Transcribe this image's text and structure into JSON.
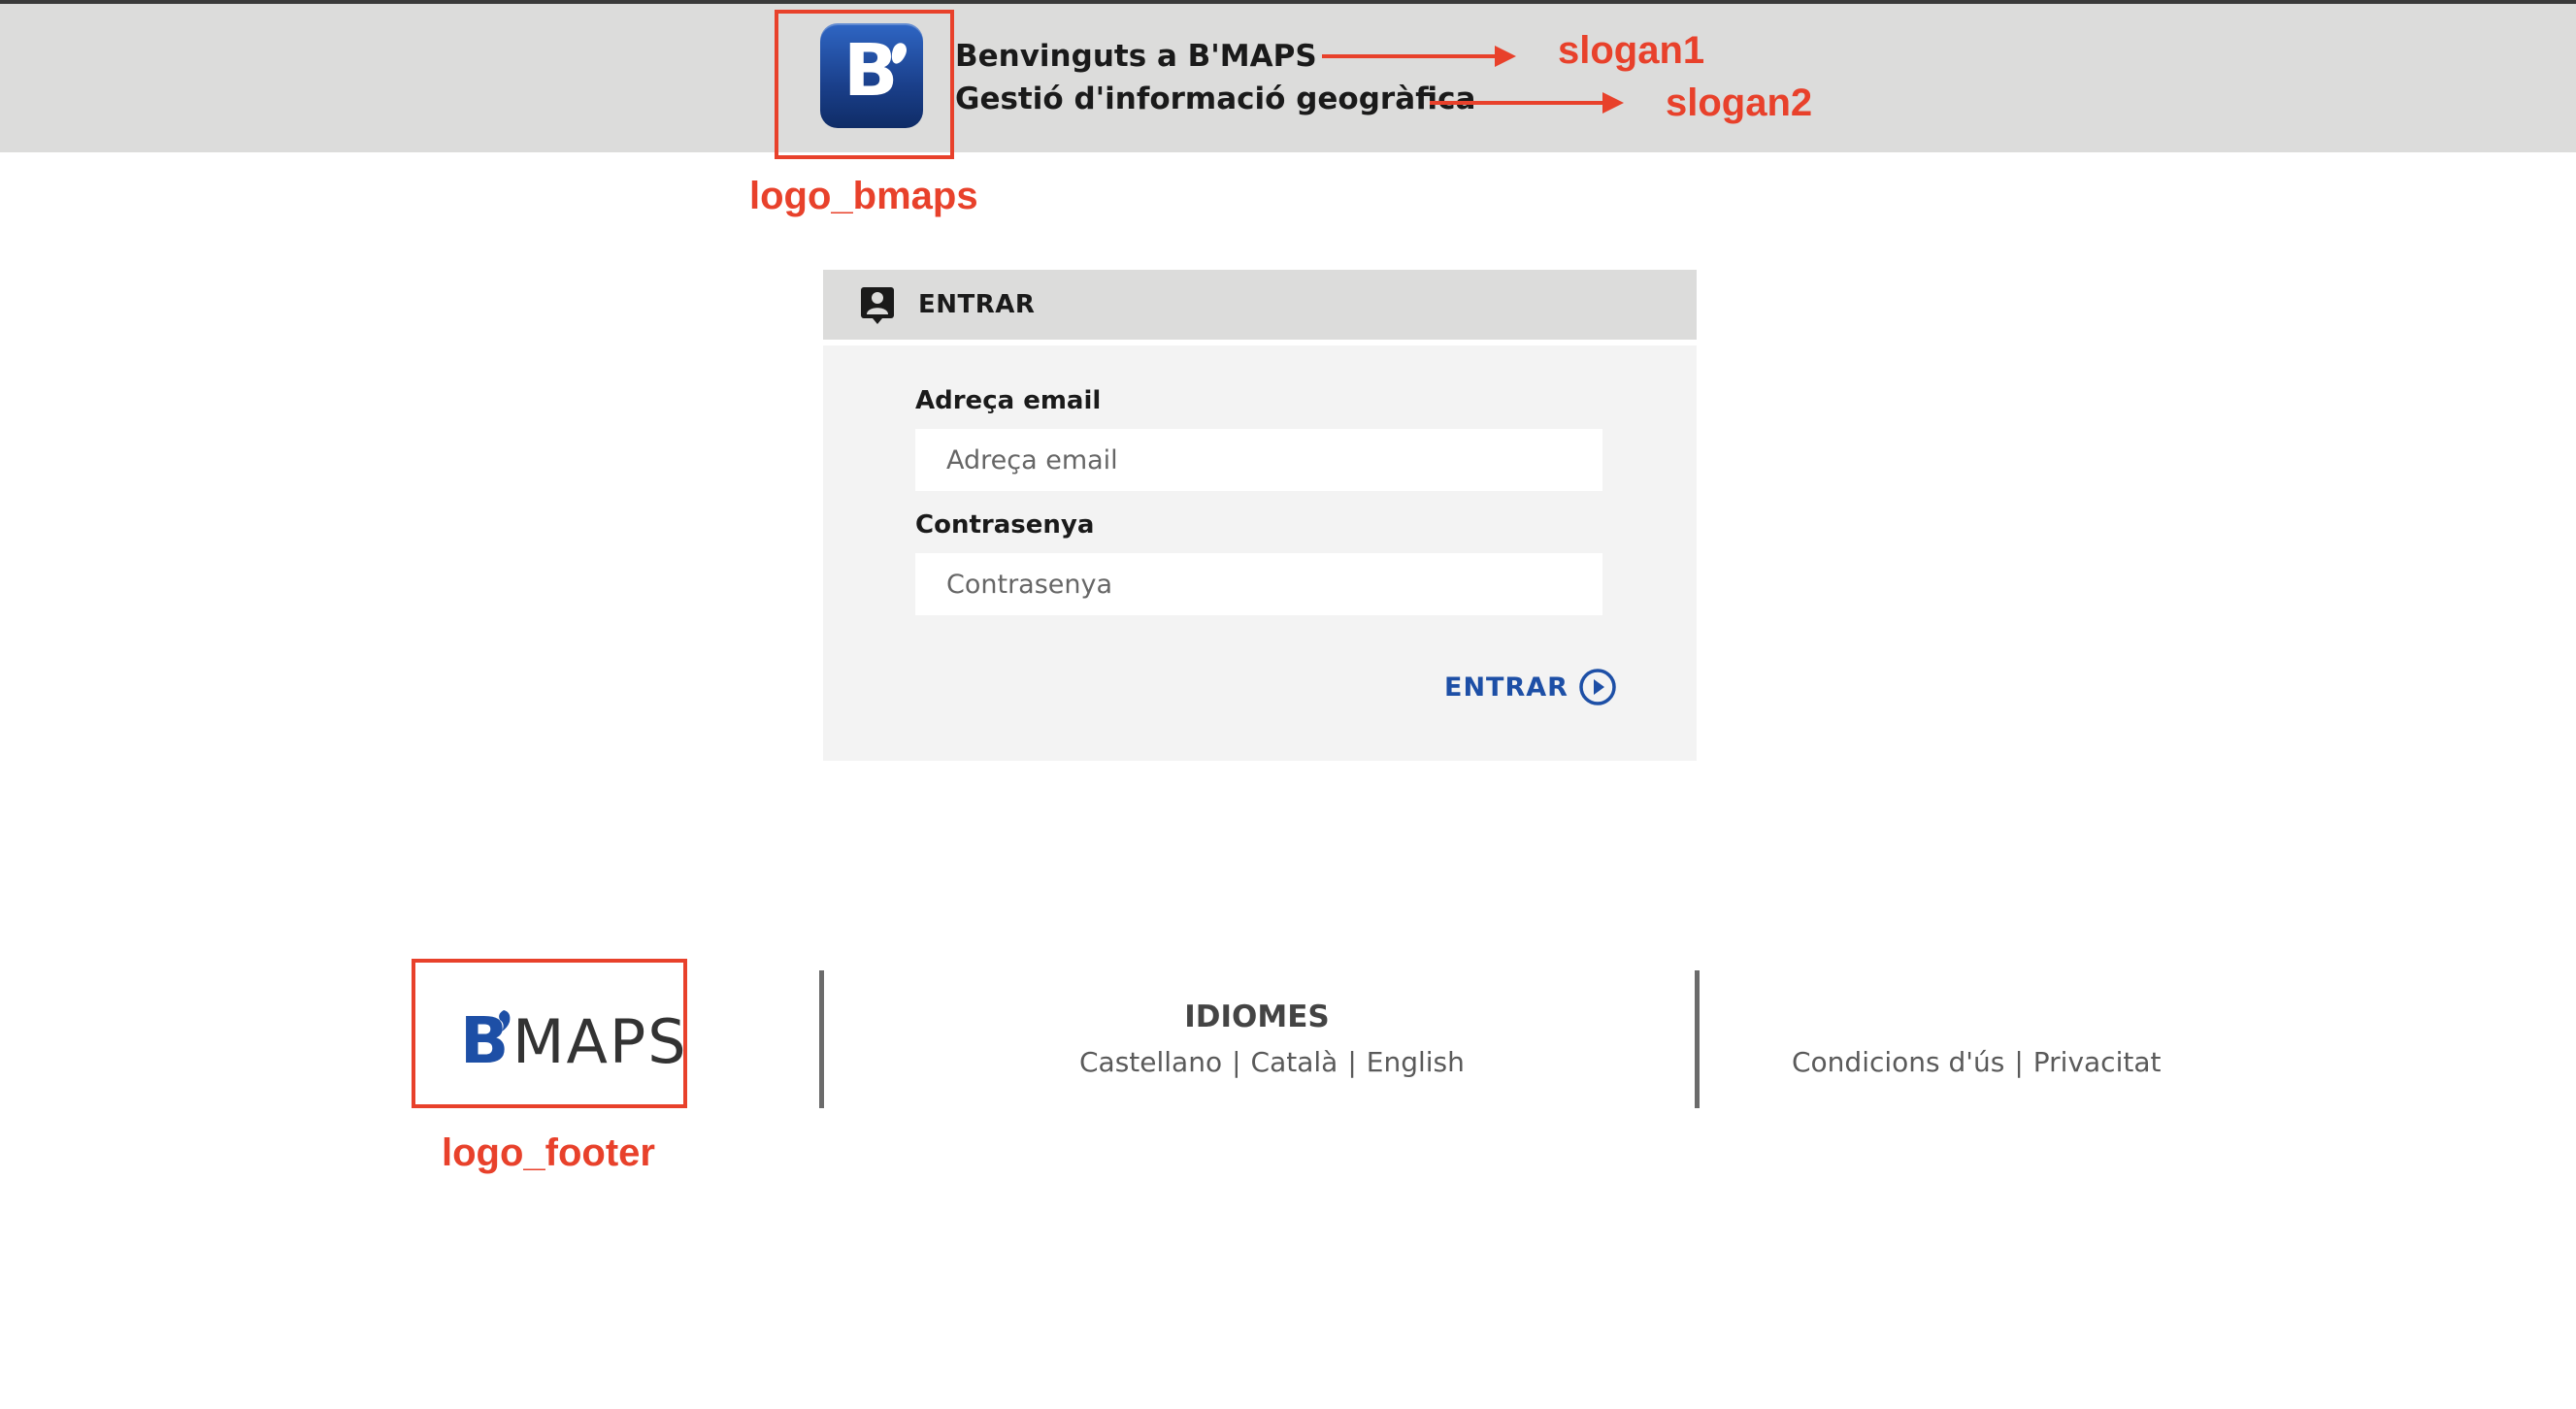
{
  "header": {
    "slogan1": "Benvinguts a B'MAPS",
    "slogan2": "Gestió d'informació geogràfica",
    "logo_letter": "B"
  },
  "annotations": {
    "logo_bmaps": "logo_bmaps",
    "slogan1": "slogan1",
    "slogan2": "slogan2",
    "logo_footer": "logo_footer"
  },
  "login": {
    "title": "ENTRAR",
    "email_label": "Adreça email",
    "email_placeholder": "Adreça email",
    "email_value": "",
    "password_label": "Contrasenya",
    "password_placeholder": "Contrasenya",
    "password_value": "",
    "submit_label": "ENTRAR"
  },
  "footer": {
    "logo_text_b": "B",
    "logo_text_maps": "MAPS",
    "languages_heading": "IDIOMES",
    "languages": [
      "Castellano",
      "Català",
      "English"
    ],
    "legal_links": [
      "Condicions d'ús",
      "Privacitat"
    ]
  },
  "colors": {
    "header_bg": "#dcdcdb",
    "panel_bg": "#f3f3f3",
    "accent_blue": "#1d4fa6",
    "annotation_red": "#e8412b"
  },
  "icons": {
    "login_icon": "user-badge-icon",
    "submit_icon": "play-circle-icon"
  }
}
